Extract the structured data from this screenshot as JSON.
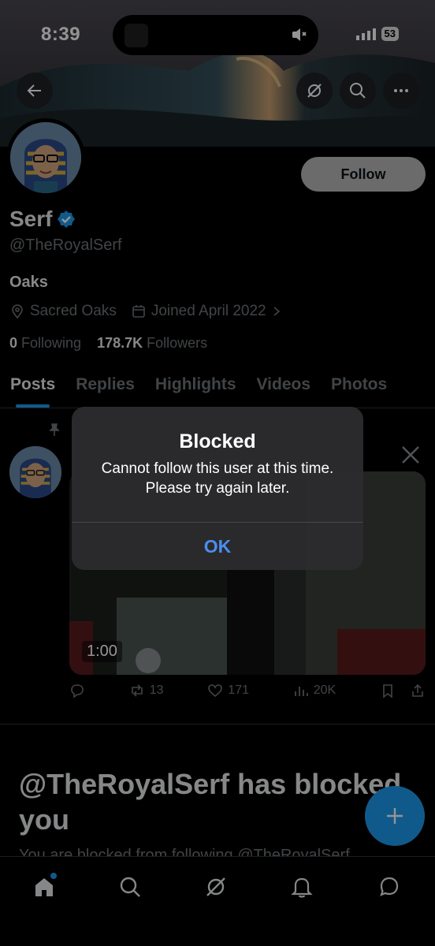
{
  "status": {
    "time": "8:39",
    "battery": "53"
  },
  "profile": {
    "name": "Serf",
    "handle": "@TheRoyalSerf",
    "bio": "Oaks",
    "location": "Sacred Oaks",
    "joined": "Joined April 2022",
    "following_count": "0",
    "following_label": "Following",
    "followers_count": "178.7K",
    "followers_label": "Followers",
    "follow_label": "Follow"
  },
  "tabs": [
    "Posts",
    "Replies",
    "Highlights",
    "Videos",
    "Photos"
  ],
  "post": {
    "video_duration": "1:00",
    "retweets": "13",
    "likes": "171",
    "views": "20K"
  },
  "blocked": {
    "title": "@TheRoyalSerf has blocked you",
    "subtitle": "You are blocked from following @TheRoyalSerf"
  },
  "alert": {
    "title": "Blocked",
    "message": "Cannot follow this user at this time. Please try again later.",
    "ok_label": "OK"
  },
  "colors": {
    "accent": "#1d9bf0",
    "alert_ok": "#4b8eef",
    "background": "#000000"
  }
}
